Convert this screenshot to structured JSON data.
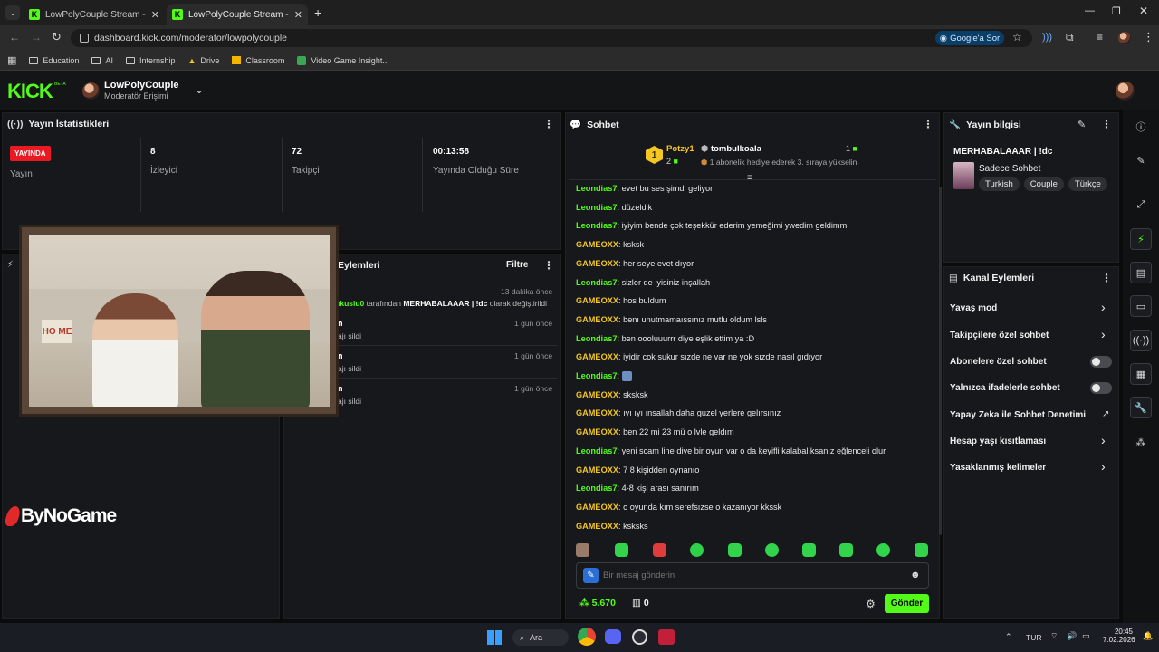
{
  "browser": {
    "tabs": [
      {
        "title": "LowPolyCouple Stream - Watch"
      },
      {
        "title": "LowPolyCouple Stream - Kick D"
      }
    ],
    "url": "dashboard.kick.com/moderator/lowpolycouple",
    "google_btn": "Google'a Sor",
    "bookmarks": [
      "Education",
      "AI",
      "Internship",
      "Drive",
      "Classroom",
      "Video Game Insight..."
    ]
  },
  "header": {
    "logo": "KICK",
    "logo_badge": "BETA",
    "channel": "LowPolyCouple",
    "role": "Moderatör Erişimi"
  },
  "stats": {
    "title": "Yayın İstatistikleri",
    "live_badge": "YAYINDA",
    "items": [
      {
        "value": "",
        "label": "Yayın"
      },
      {
        "value": "8",
        "label": "İzleyici"
      },
      {
        "value": "72",
        "label": "Takipçi"
      },
      {
        "value": "00:13:58",
        "label": "Yayında Olduğu Süre"
      }
    ]
  },
  "actions": {
    "title": "Eylemleri",
    "filter": "Filtre",
    "entries": [
      {
        "time": "13 dakika önce",
        "text_a": "ıkusiu0",
        "text_b": " tarafından ",
        "text_c": "MERHABALAAAR | !dc",
        "text_d": " olarak değiştirildi"
      },
      {
        "time": "1 gün önce",
        "name": "n",
        "desc": "ajı sildi"
      },
      {
        "time": "1 gün önce",
        "name": "n",
        "desc": "ajı sildi"
      },
      {
        "time": "1 gün önce",
        "name": "n",
        "desc": "ajı sildi"
      }
    ]
  },
  "overlay": {
    "brand": "ByNoGame",
    "pillow": "HO ME"
  },
  "chat": {
    "title": "Sohbet",
    "top_gifter": "Potzy1",
    "gifter_count": "2",
    "gift_user": "tombulkoala",
    "gift_count": "1",
    "gift_text": "1 abonelik hediye ederek 3. sıraya yükselin",
    "messages": [
      {
        "user": "Leondias7",
        "text": "evet bu ses şimdi geliyor"
      },
      {
        "user": "Leondias7",
        "text": "düzeldik"
      },
      {
        "user": "Leondias7",
        "text": "iyiyim bende çok teşekkür ederim yemeğimi ywedim geldimm"
      },
      {
        "user": "GAMEOXX",
        "text": "ksksk"
      },
      {
        "user": "GAMEOXX",
        "text": "her seye evet dıyor"
      },
      {
        "user": "Leondias7",
        "text": "sizler de iyisiniz inşallah"
      },
      {
        "user": "GAMEOXX",
        "text": "hos buldum"
      },
      {
        "user": "GAMEOXX",
        "text": "benı unutmamaıssınız mutlu oldum lsls"
      },
      {
        "user": "Leondias7",
        "text": "ben oooluuurrr diye eşlik ettim ya :D"
      },
      {
        "user": "GAMEOXX",
        "text": "iyidir cok sukur sızde ne var ne yok sızde nasıl gıdıyor"
      },
      {
        "user": "Leondias7",
        "text": ""
      },
      {
        "user": "GAMEOXX",
        "text": "sksksk"
      },
      {
        "user": "GAMEOXX",
        "text": "ıyı ıyı ınsallah daha guzel yerlere gelırsınız"
      },
      {
        "user": "GAMEOXX",
        "text": "ben 22 mi 23 mü o lvle geldım"
      },
      {
        "user": "Leondias7",
        "text": "yeni scam line diye bir oyun var o da keyifli kalabalıksanız eğlenceli olur"
      },
      {
        "user": "GAMEOXX",
        "text": "7 8 kişidden oynanıo"
      },
      {
        "user": "Leondias7",
        "text": "4-8 kişi arası sanırım"
      },
      {
        "user": "GAMEOXX",
        "text": "o oyunda kım serefsızse o kazanıyor kkssk"
      },
      {
        "user": "GAMEOXX",
        "text": "ksksks"
      }
    ],
    "placeholder": "Bir mesaj gönderin",
    "points": "5.670",
    "shop_count": "0",
    "send": "Gönder"
  },
  "stream_info": {
    "title": "Yayın bilgisi",
    "stream_title": "MERHABALAAAR | !dc",
    "category": "Sadece Sohbet",
    "tags": [
      "Turkish",
      "Couple",
      "Türkçe"
    ]
  },
  "channel_actions": {
    "title": "Kanal Eylemleri",
    "rows": [
      {
        "label": "Yavaş mod",
        "control": "chevron"
      },
      {
        "label": "Takipçilere özel sohbet",
        "control": "chevron"
      },
      {
        "label": "Abonelere özel sohbet",
        "control": "toggle"
      },
      {
        "label": "Yalnızca ifadelerle sohbet",
        "control": "toggle"
      },
      {
        "label": "Yapay Zeka ile Sohbet Denetimi",
        "control": "external"
      },
      {
        "label": "Hesap yaşı kısıtlaması",
        "control": "chevron"
      },
      {
        "label": "Yasaklanmış kelimeler",
        "control": "chevron"
      }
    ]
  },
  "taskbar": {
    "search": "Ara",
    "lang": "TUR",
    "time": "20:45",
    "date": "7.02.2026"
  },
  "colors": {
    "accent": "#53fc18",
    "live": "#e91a24",
    "gifter": "#f3c621"
  }
}
